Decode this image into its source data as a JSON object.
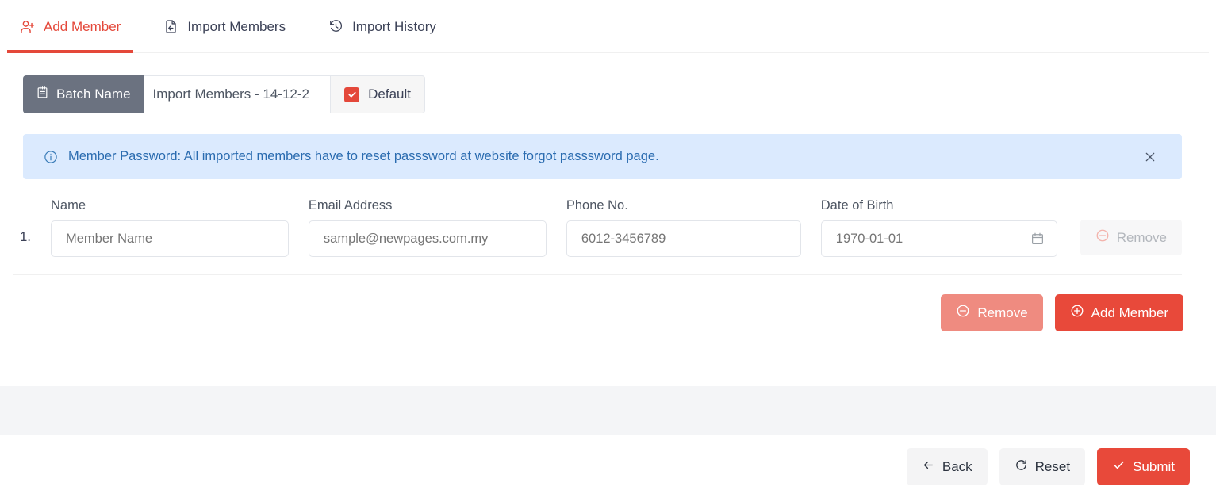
{
  "tabs": [
    {
      "id": "add-member",
      "label": "Add Member",
      "icon": "user-plus-icon",
      "active": true
    },
    {
      "id": "import-members",
      "label": "Import Members",
      "icon": "file-import-icon",
      "active": false
    },
    {
      "id": "import-history",
      "label": "Import History",
      "icon": "clock-history-icon",
      "active": false
    }
  ],
  "batch": {
    "label": "Batch Name",
    "label_icon": "notebook-icon",
    "value": "Import Members - 14-12-2",
    "default_label": "Default",
    "default_checked": true,
    "checkbox_color": "#e4483a",
    "label_bg": "#6b7280"
  },
  "alert": {
    "icon": "info-circle-icon",
    "text": "Member Password: All imported members have to reset passsword at website forgot passsword page.",
    "close_icon": "close-icon",
    "bg": "#dbeafe",
    "color": "#2b6cb0"
  },
  "form": {
    "columns": [
      {
        "key": "name",
        "label": "Name"
      },
      {
        "key": "email",
        "label": "Email Address"
      },
      {
        "key": "phone",
        "label": "Phone No."
      },
      {
        "key": "dob",
        "label": "Date of Birth"
      }
    ],
    "rows": [
      {
        "index": "1.",
        "name_placeholder": "Member Name",
        "name_value": "",
        "email_placeholder": "sample@newpages.com.my",
        "email_value": "",
        "phone_placeholder": "6012-3456789",
        "phone_value": "",
        "dob_placeholder": "1970-01-01",
        "dob_value": "",
        "dob_icon": "calendar-icon",
        "remove_label": "Remove",
        "remove_icon": "minus-circle-icon",
        "remove_disabled": true
      }
    ]
  },
  "row_actions": {
    "remove_label": "Remove",
    "remove_icon": "minus-circle-icon",
    "add_label": "Add Member",
    "add_icon": "plus-circle-icon",
    "remove_color": "#ef8b80",
    "add_color": "#e8493a"
  },
  "footer": {
    "back_label": "Back",
    "back_icon": "arrow-left-icon",
    "reset_label": "Reset",
    "reset_icon": "refresh-icon",
    "submit_label": "Submit",
    "submit_icon": "check-icon",
    "submit_color": "#e8493a"
  }
}
